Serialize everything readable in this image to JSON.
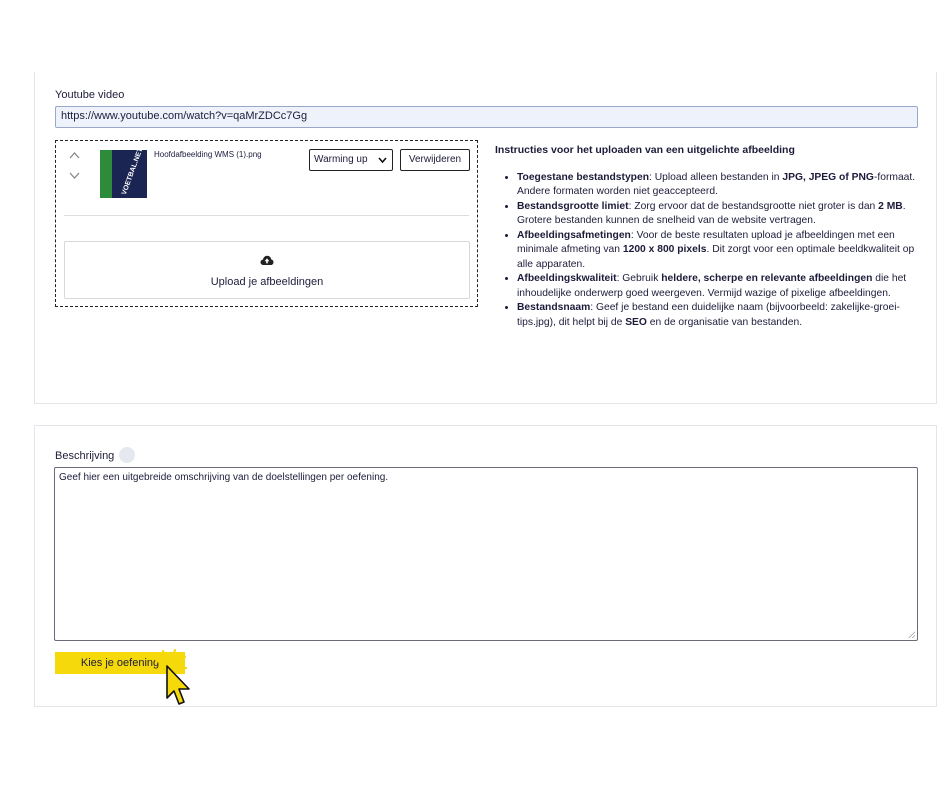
{
  "video": {
    "label": "Youtube video",
    "url": "https://www.youtube.com/watch?v=qaMrZDCc7Gg"
  },
  "upload": {
    "file_name": "Hoofdafbeelding WMS (1).png",
    "thumbnail_text": "VOETBAL.NET",
    "category_selected": "Warming up",
    "delete_label": "Verwijderen",
    "upload_label": "Upload je afbeeldingen",
    "icons": {
      "move_up": "chevron-up-icon",
      "move_down": "chevron-down-icon",
      "upload": "cloud-upload-icon"
    }
  },
  "instructions": {
    "title": "Instructies voor het uploaden van een uitgelichte afbeelding",
    "items": [
      {
        "term": "Toegestane bestandstypen",
        "text_1": ": Upload alleen bestanden in ",
        "bold_1": "JPG, JPEG of PNG",
        "text_2": "-formaat. Andere formaten worden niet geaccepteerd."
      },
      {
        "term": "Bestandsgrootte limiet",
        "text_1": ": Zorg ervoor dat de bestandsgrootte niet groter is dan ",
        "bold_1": "2 MB",
        "text_2": ". Grotere bestanden kunnen de snelheid van de website vertragen."
      },
      {
        "term": "Afbeeldingsafmetingen",
        "text_1": ": Voor de beste resultaten upload je afbeeldingen met een minimale afmeting van ",
        "bold_1": "1200 x 800 pixels",
        "text_2": ". Dit zorgt voor een optimale beeldkwaliteit op alle apparaten."
      },
      {
        "term": "Afbeeldingskwaliteit",
        "text_1": ": Gebruik ",
        "bold_1": "heldere, scherpe en relevante afbeeldingen",
        "text_2": " die het inhoudelijke onderwerp goed weergeven. Vermijd wazige of pixelige afbeeldingen."
      },
      {
        "term": "Bestandsnaam",
        "text_1": ": Geef je bestand een duidelijke naam (bijvoorbeeld: zakelijke-groei-tips.jpg), dit helpt bij de ",
        "bold_1": "SEO",
        "text_2": " en de organisatie van bestanden."
      }
    ]
  },
  "description": {
    "label": "Beschrijving",
    "value": "Geef hier een uitgebreide omschrijving van de doelstellingen per oefening.",
    "help_icon": "help-icon"
  },
  "action": {
    "choose_label": "Kies je oefening",
    "accent": "#f5d90a"
  }
}
